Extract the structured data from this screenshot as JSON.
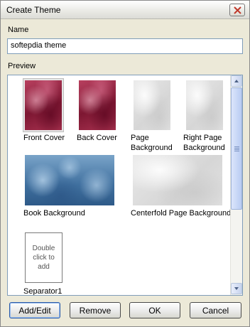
{
  "window": {
    "title": "Create Theme",
    "close_icon": "close-icon"
  },
  "name_field": {
    "label": "Name",
    "value": "softepdia theme"
  },
  "preview": {
    "label": "Preview",
    "items": [
      {
        "caption": "Front Cover"
      },
      {
        "caption": "Back Cover"
      },
      {
        "caption": "Page Background"
      },
      {
        "caption": "Right Page Background"
      },
      {
        "caption": "Book Background"
      },
      {
        "caption": "Centerfold Page Background"
      },
      {
        "caption": "Separator1",
        "placeholder_text": "Double click to add"
      }
    ]
  },
  "buttons": {
    "add_edit": "Add/Edit",
    "remove": "Remove",
    "ok": "OK",
    "cancel": "Cancel"
  },
  "colors": {
    "cover": "#8a1f3d",
    "book_background": "#3f6f9e",
    "input_border": "#7f9db9",
    "dialog_background": "#ece9d8"
  }
}
